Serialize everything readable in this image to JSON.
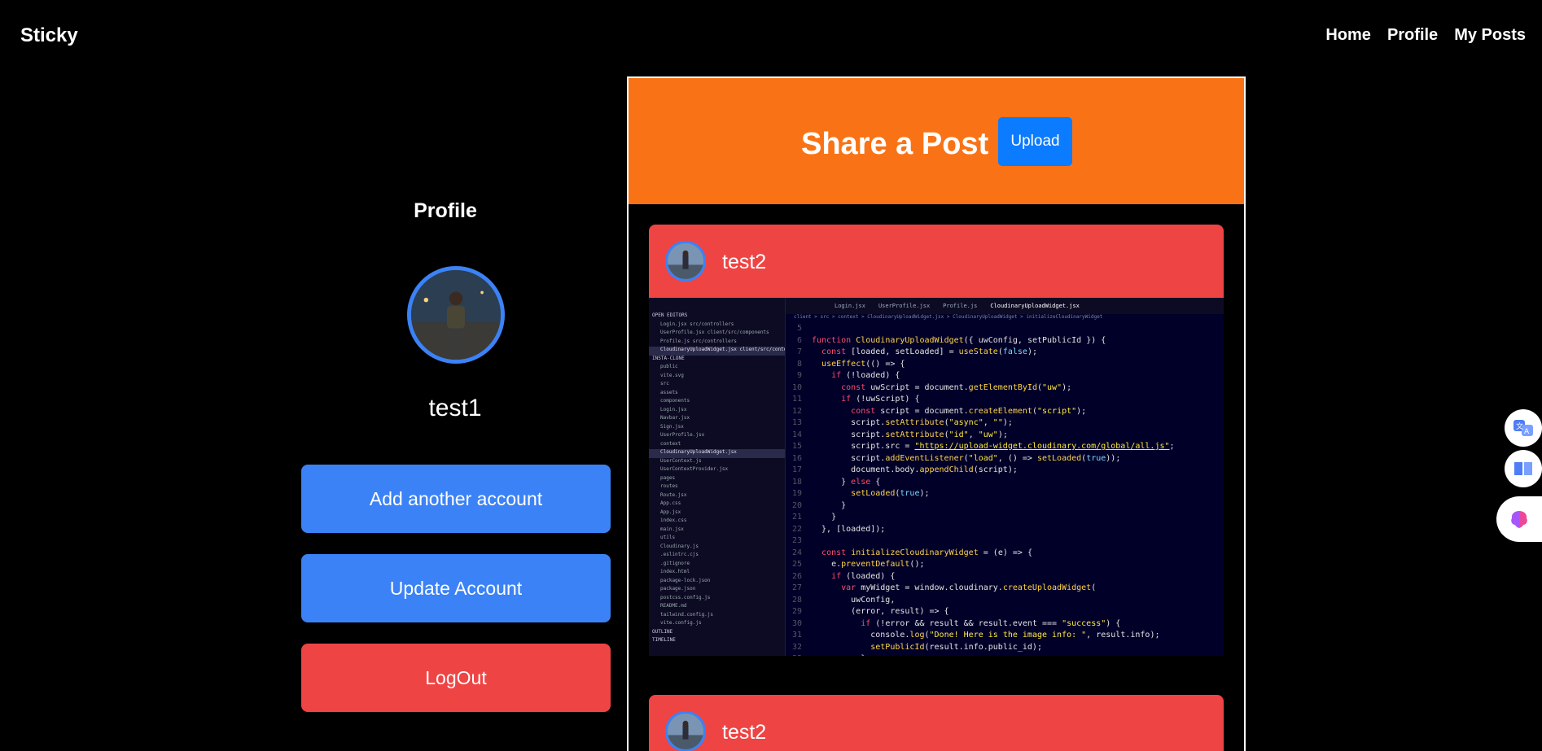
{
  "nav": {
    "brand": "Sticky",
    "links": [
      "Home",
      "Profile",
      "My Posts"
    ]
  },
  "profile": {
    "title": "Profile",
    "username": "test1",
    "buttons": {
      "add_account": "Add another account",
      "update_account": "Update Account",
      "logout": "LogOut"
    }
  },
  "feed": {
    "share_title": "Share a Post",
    "upload_label": "Upload",
    "posts": [
      {
        "username": "test2",
        "image": {
          "tabs": [
            "Login.jsx",
            "UserProfile.jsx",
            "Profile.js",
            "CloudinaryUploadWidget.jsx"
          ],
          "breadcrumb": "client > src > context > CloudinaryUploadWidget.jsx > CloudinaryUploadWidget > initializeCloudinaryWidget",
          "explorer": [
            "OPEN EDITORS",
            "Login.jsx  src/controllers",
            "UserProfile.jsx  client/src/components",
            "Profile.js  src/controllers",
            "CloudinaryUploadWidget.jsx  client/src/context",
            "INSTA-CLONE",
            "public",
            "vite.svg",
            "src",
            "assets",
            "components",
            "Login.jsx",
            "Navbar.jsx",
            "Sign.jsx",
            "UserProfile.jsx",
            "context",
            "CloudinaryUploadWidget.jsx",
            "UserContext.js",
            "UserContextProvider.jsx",
            "pages",
            "routes",
            "Route.jsx",
            "App.css",
            "App.jsx",
            "index.css",
            "main.jsx",
            "utils",
            "Cloudinary.js",
            ".eslintrc.cjs",
            ".gitignore",
            "index.html",
            "package-lock.json",
            "package.json",
            "postcss.config.js",
            "README.md",
            "tailwind.config.js",
            "vite.config.js",
            "OUTLINE",
            "TIMELINE"
          ],
          "first_line": 5
        }
      },
      {
        "username": "test2"
      }
    ]
  },
  "side_widgets": [
    "translate-icon",
    "book-icon",
    "brain-icon"
  ],
  "colors": {
    "background": "#000000",
    "share_header": "#f97316",
    "post_header": "#ef4444",
    "primary_button": "#3b82f6",
    "logout_button": "#ef4444",
    "upload_button": "#0b7bff"
  }
}
